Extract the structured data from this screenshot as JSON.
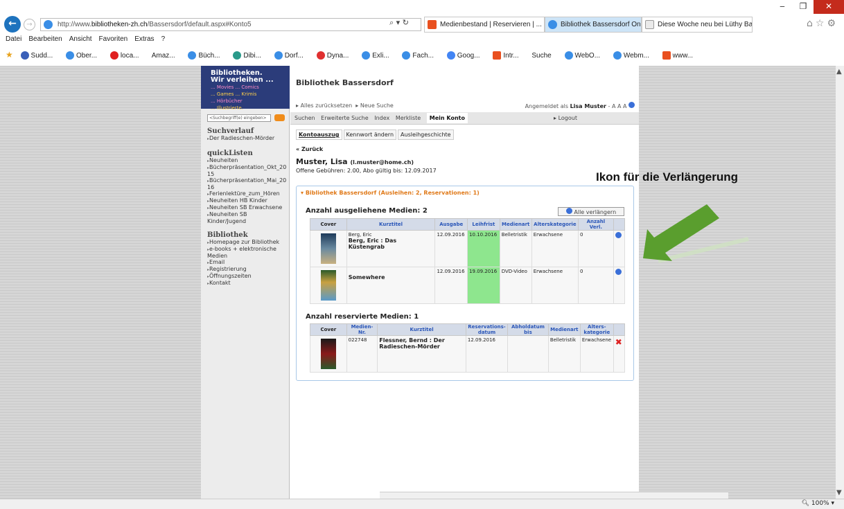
{
  "browser": {
    "url_prefix": "http://www.",
    "url_host": "bibliotheken-zh.ch",
    "url_path": "/Bassersdorf/default.aspx#Konto5",
    "tabs": [
      {
        "label": "Medienbestand | Reservieren | ...",
        "icon_color": "#e9501f"
      },
      {
        "label": "Bibliothek Bassersdorf Onli...",
        "icon_color": "#3a8ee6",
        "close": "×"
      },
      {
        "label": "Diese Woche neu bei Lüthy Bal...",
        "icon_color": "#eaeaea"
      }
    ],
    "menu": [
      "Datei",
      "Bearbeiten",
      "Ansicht",
      "Favoriten",
      "Extras",
      "?"
    ],
    "favorites": [
      "Sudd...",
      "Ober...",
      "loca...",
      "Amaz...",
      "Büch...",
      "Dibi...",
      "Dorf...",
      "Dyna...",
      "Exli...",
      "Fach...",
      "Goog...",
      "Intr...",
      "Suche",
      "WebO...",
      "Webm...",
      "www..."
    ],
    "zoom": "100%"
  },
  "site": {
    "logo_lines": [
      "Bibliotheken.",
      "Wir verleihen ...",
      "... Movies ... Comics",
      "... Games ... Krimis",
      "... Hörbücher",
      "... Illustrierte."
    ],
    "search_placeholder": "<Suchbegriff(e) eingeben>",
    "sidebar": {
      "history_title": "Suchverlauf",
      "history_items": [
        "Der Radieschen-Mörder"
      ],
      "quick_title": "quickListen",
      "quick_items": [
        "Neuheiten",
        "Bücherpräsentation_Okt_20 15",
        "Bücherpräsentation_Mai_20 16",
        "Ferienlektüre_zum_Hören",
        "Neuheiten HB Kinder",
        "Neuheiten SB Erwachsene",
        "Neuheiten SB Kinder/Jugend"
      ],
      "lib_title": "Bibliothek",
      "lib_items": [
        "Homepage zur Bibliothek",
        "e-books + elektronische Medien",
        "Email",
        "Registrierung",
        "Öffnungszeiten",
        "Kontakt"
      ]
    },
    "title": "Bibliothek Bassersdorf",
    "toplinks": [
      "Alles zurücksetzen",
      "Neue Suche"
    ],
    "logged_in_prefix": "Angemeldet als",
    "logged_in_user": "Lisa Muster",
    "font_sizes": "- A A A",
    "nav": [
      "Suchen",
      "Erweiterte Suche",
      "Index",
      "Merkliste",
      "Mein Konto"
    ],
    "logout": "Logout",
    "subtabs": [
      "Kontoauszug",
      "Kennwort ändern",
      "Ausleihgeschichte"
    ],
    "back": "« Zurück",
    "user_name": "Muster, Lisa",
    "user_mail": "(l.muster@home.ch)",
    "user_info": "Offene Gebühren: 2.00, Abo gültig bis: 12.09.2017",
    "box_header": "Bibliothek Bassersdorf (Ausleihen: 2, Reservationen: 1)",
    "loans_title": "Anzahl ausgeliehene Medien: 2",
    "renew_all": "Alle verlängern",
    "loan_headers": [
      "Cover",
      "Kurztitel",
      "Ausgabe",
      "Leihfrist",
      "Medienart",
      "Alterskategorie",
      "Anzahl Verl."
    ],
    "loans": [
      {
        "author": "Berg, Eric",
        "title": "Berg, Eric : Das Küstengrab",
        "ausgabe": "12.09.2016",
        "leihfrist": "10.10.2016",
        "medienart": "Belletristik",
        "alter": "Erwachsene",
        "anzahl": "0"
      },
      {
        "author": "",
        "title": "Somewhere",
        "ausgabe": "12.09.2016",
        "leihfrist": "19.09.2016",
        "medienart": "DVD-Video",
        "alter": "Erwachsene",
        "anzahl": "0"
      }
    ],
    "res_title": "Anzahl reservierte Medien: 1",
    "res_headers": [
      "Cover",
      "Medien-Nr.",
      "Kurztitel",
      "Reservations-datum",
      "Abholdatum bis",
      "Medienart",
      "Alters-kategorie"
    ],
    "reservations": [
      {
        "nr": "022748",
        "title": "Flessner, Bernd : Der Radieschen-Mörder",
        "datum": "12.09.2016",
        "abhol": "",
        "medienart": "Belletristik",
        "alter": "Erwachsene"
      }
    ]
  },
  "annotation": "Ikon für die Verlängerung",
  "colors": {
    "arrow": "#5a9e2e",
    "green_cell": "#8ee68e",
    "accent_orange": "#e07a1a",
    "header_blue": "#2a56b8"
  }
}
